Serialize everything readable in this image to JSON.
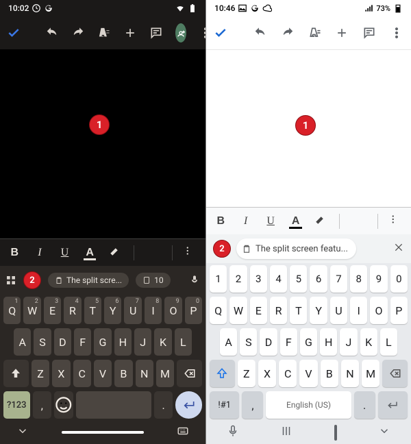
{
  "left": {
    "status": {
      "time": "10:02",
      "icons": [
        "clock",
        "google"
      ],
      "right": [
        "wifi",
        "battery"
      ]
    },
    "marker1": "1",
    "marker2": "2",
    "fmt": {
      "b": "B",
      "i": "I",
      "u": "U",
      "a": "A"
    },
    "suggest": {
      "clip_text": "The split scre...",
      "count": "10"
    },
    "keys": {
      "row1": [
        "Q",
        "W",
        "E",
        "R",
        "T",
        "Y",
        "U",
        "I",
        "O",
        "P"
      ],
      "row1_sup": [
        "1",
        "2",
        "3",
        "4",
        "5",
        "6",
        "7",
        "8",
        "9",
        "0"
      ],
      "row2": [
        "A",
        "S",
        "D",
        "F",
        "G",
        "H",
        "J",
        "K",
        "L"
      ],
      "row3": [
        "Z",
        "X",
        "C",
        "V",
        "B",
        "N",
        "M"
      ],
      "numtoggle": "?123",
      "comma": ",",
      "period": "."
    }
  },
  "right": {
    "status": {
      "time": "10:46",
      "icons": [
        "image",
        "google",
        "cloud"
      ],
      "battery": "73%"
    },
    "marker1": "1",
    "marker2": "2",
    "fmt": {
      "b": "B",
      "i": "I",
      "u": "U",
      "a": "A"
    },
    "clip_text": "The split screen featu...",
    "keys": {
      "numrow": [
        "1",
        "2",
        "3",
        "4",
        "5",
        "6",
        "7",
        "8",
        "9",
        "0"
      ],
      "row1": [
        "Q",
        "W",
        "E",
        "R",
        "T",
        "Y",
        "U",
        "I",
        "O",
        "P"
      ],
      "row2": [
        "A",
        "S",
        "D",
        "F",
        "G",
        "H",
        "J",
        "K",
        "L"
      ],
      "row3": [
        "Z",
        "X",
        "C",
        "V",
        "B",
        "N",
        "M"
      ],
      "numtoggle": "!#1",
      "comma": ",",
      "space": "English (US)",
      "period": "."
    }
  }
}
